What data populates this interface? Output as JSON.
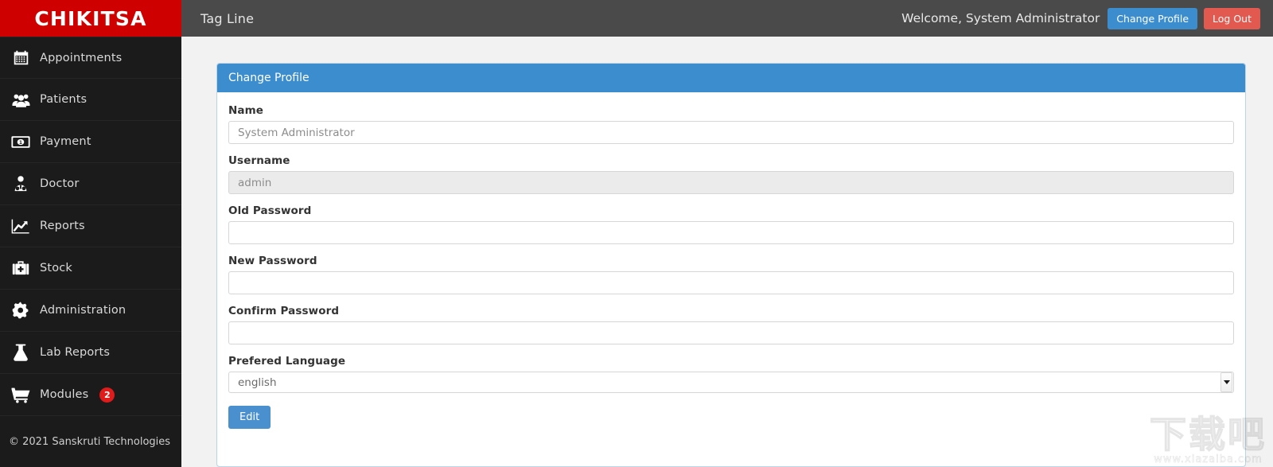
{
  "brand": {
    "name": "CHIKITSA",
    "color": "#ce0000"
  },
  "sidebar": {
    "items": [
      {
        "label": "Appointments",
        "icon": "calendar-icon"
      },
      {
        "label": "Patients",
        "icon": "users-icon"
      },
      {
        "label": "Payment",
        "icon": "money-bill-icon"
      },
      {
        "label": "Doctor",
        "icon": "doctor-icon"
      },
      {
        "label": "Reports",
        "icon": "chart-line-icon"
      },
      {
        "label": "Stock",
        "icon": "medkit-icon"
      },
      {
        "label": "Administration",
        "icon": "gear-icon"
      },
      {
        "label": "Lab Reports",
        "icon": "flask-icon"
      },
      {
        "label": "Modules",
        "icon": "shopping-cart-icon",
        "badge": "2"
      }
    ],
    "copyright": "© 2021 Sanskruti Technologies"
  },
  "topbar": {
    "tagline": "Tag Line",
    "welcome": "Welcome, System Administrator",
    "change_profile_label": "Change Profile",
    "log_out_label": "Log Out",
    "primary_color": "#3c8dcd",
    "danger_color": "#e2594f"
  },
  "panel": {
    "title": "Change Profile",
    "header_color": "#3c8dcd"
  },
  "form": {
    "name": {
      "label": "Name",
      "value": "System Administrator",
      "placeholder": "System Administrator"
    },
    "username": {
      "label": "Username",
      "value": "admin",
      "placeholder": "admin",
      "disabled": "true"
    },
    "old_password": {
      "label": "Old Password",
      "value": "",
      "placeholder": ""
    },
    "new_password": {
      "label": "New Password",
      "value": "",
      "placeholder": ""
    },
    "confirm_password": {
      "label": "Confirm Password",
      "value": "",
      "placeholder": ""
    },
    "prefered_language": {
      "label": "Prefered Language",
      "selected": "english",
      "options": [
        "english"
      ]
    },
    "submit_label": "Edit"
  },
  "watermark": {
    "text": "下载吧",
    "url": "www.xiazaiba.com"
  }
}
